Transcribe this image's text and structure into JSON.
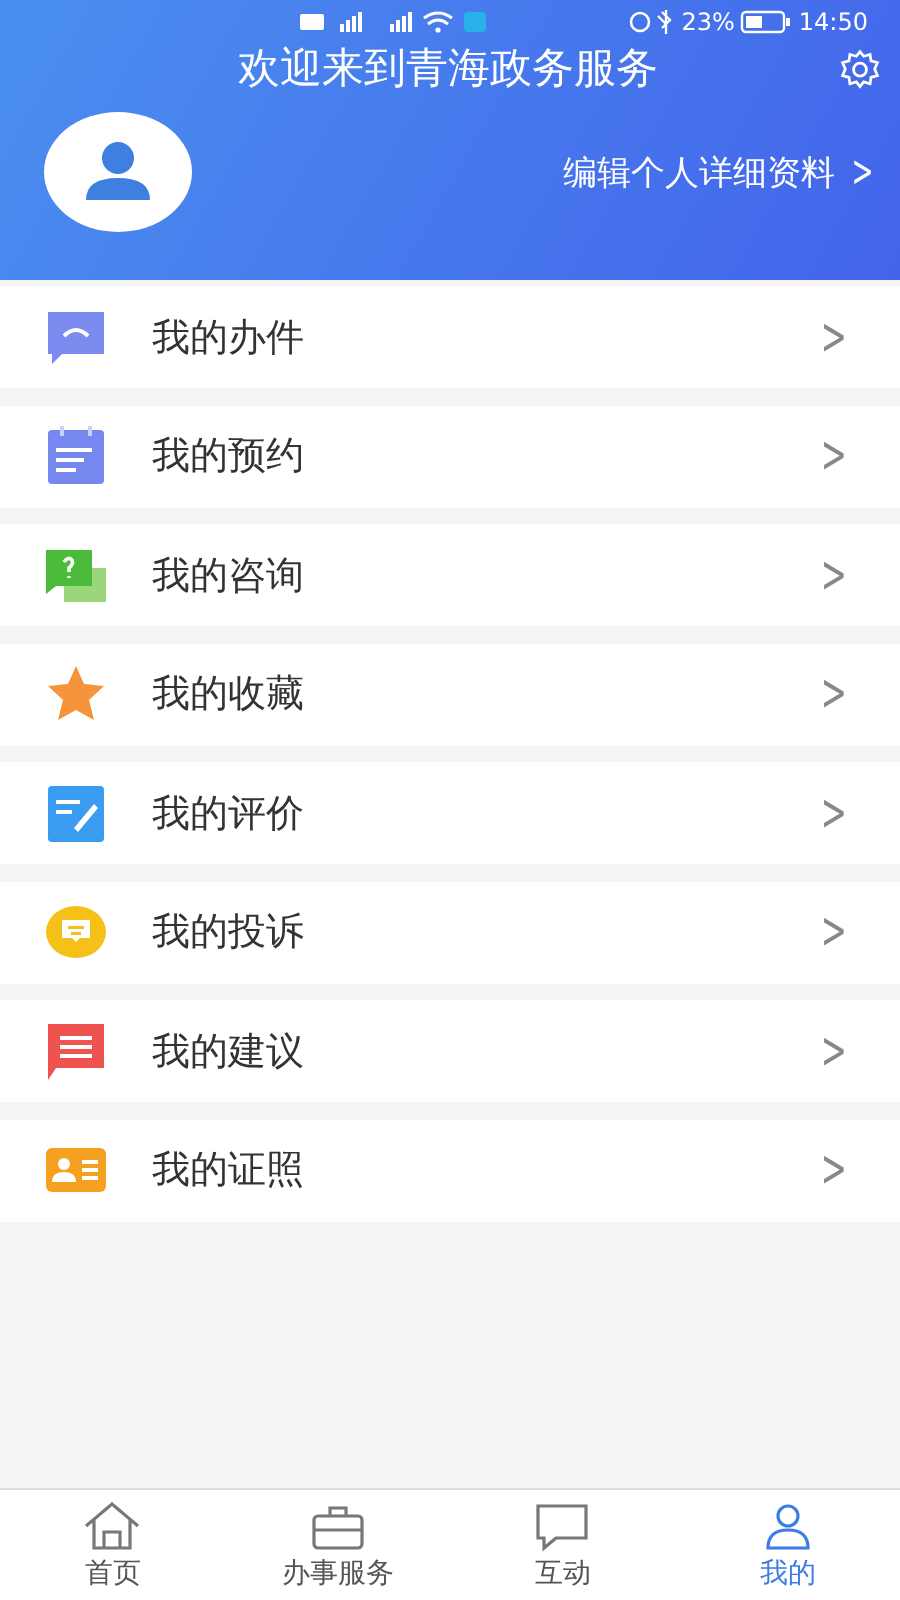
{
  "status_bar": {
    "battery": "23%",
    "time": "14:50"
  },
  "header": {
    "title": "欢迎来到青海政务服务",
    "edit_link": "编辑个人详细资料",
    "edit_chevron": ">"
  },
  "menu": [
    {
      "kind": "chat",
      "label": "我的办件",
      "chevron": ">"
    },
    {
      "kind": "calendar",
      "label": "我的预约",
      "chevron": ">"
    },
    {
      "kind": "question",
      "label": "我的咨询",
      "chevron": ">"
    },
    {
      "kind": "star",
      "label": "我的收藏",
      "chevron": ">"
    },
    {
      "kind": "edit",
      "label": "我的评价",
      "chevron": ">"
    },
    {
      "kind": "complaint",
      "label": "我的投诉",
      "chevron": ">"
    },
    {
      "kind": "suggest",
      "label": "我的建议",
      "chevron": ">"
    },
    {
      "kind": "card",
      "label": "我的证照",
      "chevron": ">"
    }
  ],
  "tabs": [
    {
      "kind": "home",
      "label": "首页",
      "selected": false
    },
    {
      "kind": "service",
      "label": "办事服务",
      "selected": false
    },
    {
      "kind": "chat",
      "label": "互动",
      "selected": false
    },
    {
      "kind": "user",
      "label": "我的",
      "selected": true
    }
  ]
}
